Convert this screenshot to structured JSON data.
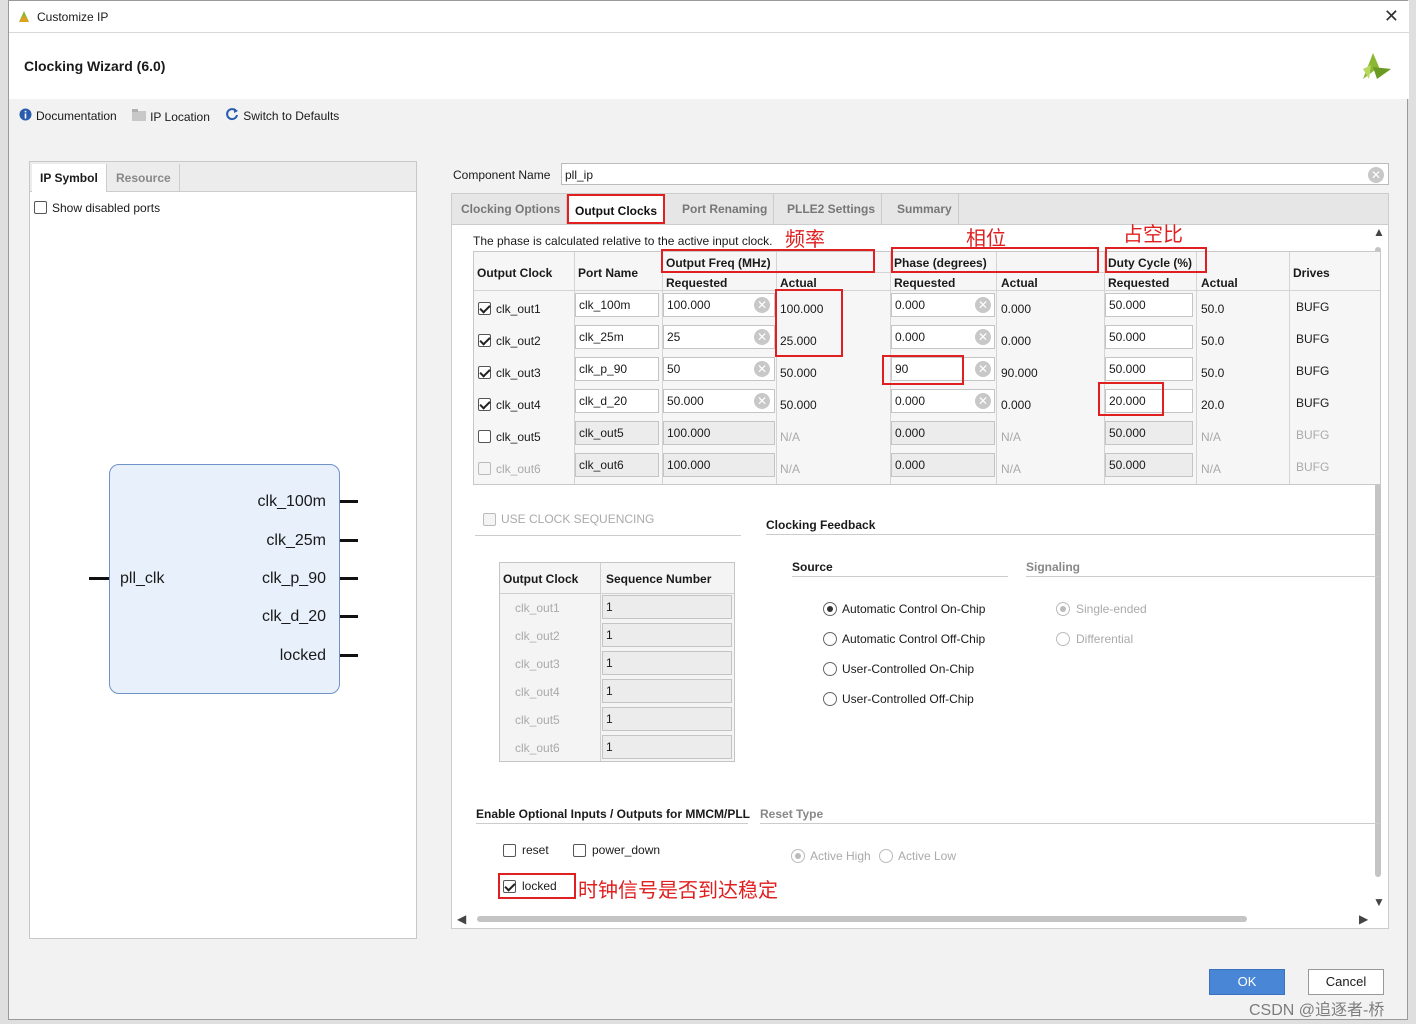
{
  "window": {
    "title": "Customize IP",
    "close_glyph": "✕"
  },
  "header": {
    "title": "Clocking Wizard (6.0)"
  },
  "toolbar": {
    "documentation": "Documentation",
    "ip_location": "IP Location",
    "switch_defaults": "Switch to Defaults"
  },
  "left_panel": {
    "tabs": [
      "IP Symbol",
      "Resource"
    ],
    "show_disabled_ports": "Show disabled ports",
    "symbol": {
      "input": "pll_clk",
      "outputs": [
        "clk_100m",
        "clk_25m",
        "clk_p_90",
        "clk_d_20",
        "locked"
      ]
    }
  },
  "component": {
    "label": "Component Name",
    "value": "pll_ip"
  },
  "tabs": [
    "Clocking Options",
    "Output Clocks",
    "Port Renaming",
    "PLLE2 Settings",
    "Summary"
  ],
  "output_clocks": {
    "note": "The phase is calculated relative to the active input clock.",
    "headers": {
      "output_clock": "Output Clock",
      "port_name": "Port Name",
      "output_freq": "Output Freq (MHz)",
      "phase": "Phase (degrees)",
      "duty": "Duty Cycle (%)",
      "requested": "Requested",
      "actual": "Actual",
      "drives": "Drives"
    },
    "rows": [
      {
        "clock": "clk_out1",
        "checked": true,
        "port": "clk_100m",
        "freq_req": "100.000",
        "freq_act": "100.000",
        "phase_req": "0.000",
        "phase_act": "0.000",
        "duty_req": "50.000",
        "duty_act": "50.0",
        "drives": "BUFG"
      },
      {
        "clock": "clk_out2",
        "checked": true,
        "port": "clk_25m",
        "freq_req": "25",
        "freq_act": "25.000",
        "phase_req": "0.000",
        "phase_act": "0.000",
        "duty_req": "50.000",
        "duty_act": "50.0",
        "drives": "BUFG"
      },
      {
        "clock": "clk_out3",
        "checked": true,
        "port": "clk_p_90",
        "freq_req": "50",
        "freq_act": "50.000",
        "phase_req": "90",
        "phase_act": "90.000",
        "duty_req": "50.000",
        "duty_act": "50.0",
        "drives": "BUFG"
      },
      {
        "clock": "clk_out4",
        "checked": true,
        "port": "clk_d_20",
        "freq_req": "50.000",
        "freq_act": "50.000",
        "phase_req": "0.000",
        "phase_act": "0.000",
        "duty_req": "20.000",
        "duty_act": "20.0",
        "drives": "BUFG"
      },
      {
        "clock": "clk_out5",
        "checked": false,
        "port": "clk_out5",
        "freq_req": "100.000",
        "freq_act": "N/A",
        "phase_req": "0.000",
        "phase_act": "N/A",
        "duty_req": "50.000",
        "duty_act": "N/A",
        "drives": "BUFG"
      },
      {
        "clock": "clk_out6",
        "checked": false,
        "port": "clk_out6",
        "freq_req": "100.000",
        "freq_act": "N/A",
        "phase_req": "0.000",
        "phase_act": "N/A",
        "duty_req": "50.000",
        "duty_act": "N/A",
        "drives": "BUFG"
      }
    ]
  },
  "sequencing": {
    "label": "USE CLOCK SEQUENCING",
    "headers": {
      "output_clock": "Output Clock",
      "sequence_number": "Sequence Number"
    },
    "rows": [
      {
        "clock": "clk_out1",
        "seq": "1"
      },
      {
        "clock": "clk_out2",
        "seq": "1"
      },
      {
        "clock": "clk_out3",
        "seq": "1"
      },
      {
        "clock": "clk_out4",
        "seq": "1"
      },
      {
        "clock": "clk_out5",
        "seq": "1"
      },
      {
        "clock": "clk_out6",
        "seq": "1"
      }
    ]
  },
  "feedback": {
    "title": "Clocking Feedback",
    "source_label": "Source",
    "signaling_label": "Signaling",
    "sources": [
      "Automatic Control On-Chip",
      "Automatic Control Off-Chip",
      "User-Controlled On-Chip",
      "User-Controlled Off-Chip"
    ],
    "signaling": [
      "Single-ended",
      "Differential"
    ]
  },
  "optional": {
    "title": "Enable Optional Inputs / Outputs for MMCM/PLL",
    "reset_type": "Reset Type",
    "reset": "reset",
    "power_down": "power_down",
    "locked": "locked",
    "active_high": "Active High",
    "active_low": "Active Low"
  },
  "annotations": {
    "freq": "频率",
    "phase": "相位",
    "duty": "占空比",
    "locked": "时钟信号是否到达稳定"
  },
  "buttons": {
    "ok": "OK",
    "cancel": "Cancel"
  },
  "watermark": "CSDN @追逐者-桥",
  "colors": {
    "accent": "#4a86d6",
    "annotation": "#e02020",
    "symbol_fill": "#e8f0fb"
  }
}
